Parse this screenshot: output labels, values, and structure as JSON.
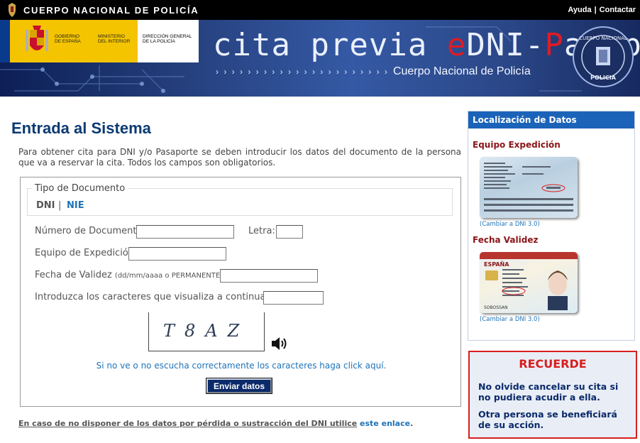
{
  "header": {
    "org_name": "CUERPO NACIONAL DE POLICÍA",
    "links": [
      "Ayuda",
      "Contactar"
    ]
  },
  "banner": {
    "gov_line1": "GOBIERNO",
    "gov_line2": "DE ESPAÑA",
    "ministry_line1": "MINISTERIO",
    "ministry_line2": "DEL INTERIOR",
    "direction_line1": "DIRECCIÓN GENERAL",
    "direction_line2": "DE LA POLICÍA",
    "title_part1": "cita previa ",
    "title_e": "e",
    "title_part2": "DNI-",
    "title_p": "P",
    "title_part3": "asaporte",
    "arrows": "› › › › › › › › › › › › › › › › › › › › › ›",
    "subtitle": "Cuerpo Nacional de Policía",
    "badge_text_top": "CUERPO NACIONAL",
    "badge_text_bottom": "POLICIA"
  },
  "main": {
    "title": "Entrada al Sistema",
    "intro": "Para obtener cita para DNI y/o Pasaporte se deben introducir los datos del documento de la persona que va a reservar la cita. Todos los campos son obligatorios."
  },
  "form": {
    "doc_type_legend": "Tipo de Documento",
    "doc_type_dni": "DNI",
    "doc_type_separator": "|",
    "doc_type_nie": "NIE",
    "doc_number_label": "Número de Documento:",
    "doc_number_value": "",
    "letter_label": "Letra:",
    "letter_value": "",
    "team_label": "Equipo de Expedición:",
    "team_value": "",
    "validity_label": "Fecha de Validez",
    "validity_hint": "(dd/mm/aaaa o PERMANENTE)",
    "validity_colon": ":",
    "validity_value": "",
    "captcha_label": "Introduzca los caracteres que visualiza a continuación:",
    "captcha_value": "",
    "captcha_chars": "T8AZ",
    "cant_see_text": "Si no ve o no escucha correctamente los caracteres haga click aquí.",
    "submit_label": "Enviar datos"
  },
  "footer_note": {
    "text": "En caso de no disponer de los datos por pérdida o sustracción del DNI utilice",
    "link": "este enlace",
    "end": "."
  },
  "sidebar": {
    "header": "Localización de Datos",
    "equipo_label": "Equipo Expedición",
    "change_link_1": "(Cambiar a DNI 3.0)",
    "validez_label": "Fecha Validez",
    "change_link_2": "(Cambiar a DNI 3.0)",
    "card2_country": "ESPAÑA",
    "card2_surname": "SOBOSSAN"
  },
  "remember": {
    "title": "RECUERDE",
    "p1": "No olvide cancelar su cita si no pudiera acudir a ella.",
    "p2": "Otra persona se beneficiará de su acción."
  },
  "colors": {
    "title_blue": "#0b3a73",
    "link_blue": "#1f73b8",
    "dark_red": "#8b1418",
    "alert_red": "#d81e1e",
    "button_navy": "#0b2a6a",
    "sidebar_header": "#1b63b8"
  }
}
